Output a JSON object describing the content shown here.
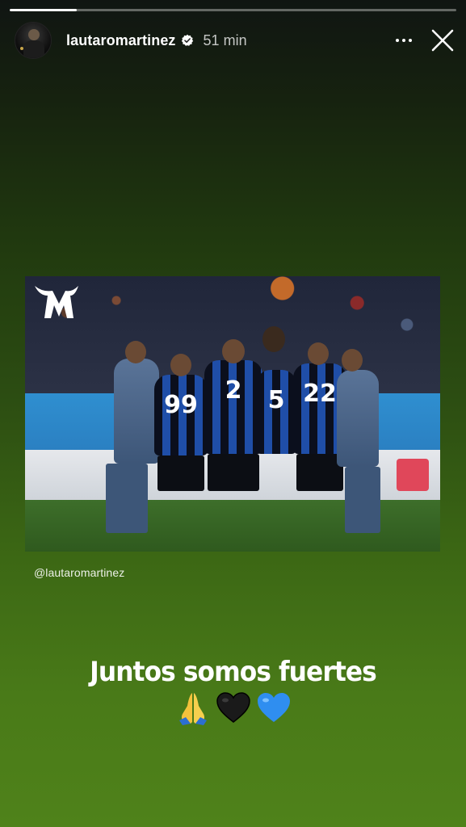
{
  "story": {
    "progress": 0.15,
    "username": "lautaromartinez",
    "verified": true,
    "time": "51 min",
    "mention": "@lautaromartinez",
    "caption": "Juntos somos fuertes",
    "emojis": [
      "folded-hands",
      "black-heart",
      "blue-heart"
    ]
  },
  "photo": {
    "logo": "LM",
    "jersey_numbers": [
      "99",
      "2",
      "5",
      "22"
    ]
  },
  "colors": {
    "background_top": "#101512",
    "background_bottom": "#4f821a",
    "jersey_blue": "#1f4ea8",
    "jersey_black": "#0b0f1d",
    "verified_blue": "#3897f0"
  },
  "icons": {
    "more": "more-horizontal-icon",
    "close": "close-icon",
    "verified": "verified-badge-icon"
  }
}
